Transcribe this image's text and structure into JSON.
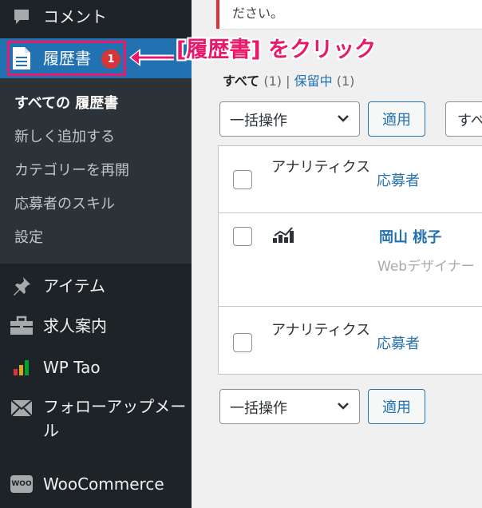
{
  "sidebar": {
    "items": [
      {
        "label": "コメント",
        "icon": "comment-icon"
      },
      {
        "label": "履歴書",
        "icon": "document-icon",
        "badge": "1"
      },
      {
        "label": "アイテム",
        "icon": "pin-icon"
      },
      {
        "label": "求人案内",
        "icon": "briefcase-icon"
      },
      {
        "label": "WP Tao",
        "icon": "bar-chart-icon"
      },
      {
        "label": "フォローアップメール",
        "icon": "envelope-icon"
      },
      {
        "label": "WooCommerce",
        "icon": "woo-icon",
        "icon_text": "WOO"
      }
    ],
    "submenu": [
      {
        "label": "すべての 履歴書"
      },
      {
        "label": "新しく追加する"
      },
      {
        "label": "カテゴリーを再開"
      },
      {
        "label": "応募者のスキル"
      },
      {
        "label": "設定"
      }
    ]
  },
  "annotation": {
    "text": "[履歴書] をクリック",
    "color": "#e8196a"
  },
  "notice": {
    "text": "ださい。"
  },
  "views": {
    "all_label": "すべて",
    "all_count": "(1)",
    "separator": "|",
    "pending_label": "保留中",
    "pending_count": "(1)"
  },
  "bulk_actions": {
    "select_label": "一括操作",
    "apply_label": "適用"
  },
  "filter": {
    "label": "すべ"
  },
  "table": {
    "columns": {
      "analytics": "アナリティクス",
      "applicant": "応募者"
    },
    "rows": [
      {
        "name": "岡山 桃子",
        "job": "Webデザイナー"
      }
    ]
  },
  "colors": {
    "sidebar_bg": "#1d2327",
    "active_bg": "#2271b1",
    "badge": "#d63638",
    "link": "#2271b1"
  }
}
